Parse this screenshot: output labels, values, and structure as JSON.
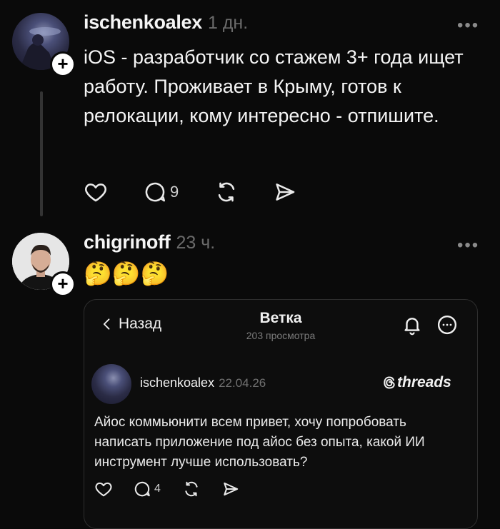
{
  "post1": {
    "username": "ischenkoalex",
    "time": "1 дн.",
    "text": "iOS - разработчик со стажем 3+ года ищет работу. Проживает в Крыму, готов к релокации, кому интересно - отпишите.",
    "more": "•••",
    "reply_count": "9",
    "plus": "+"
  },
  "post2": {
    "username": "chigrinoff",
    "time": "23 ч.",
    "emojis": "🤔🤔🤔",
    "more": "•••",
    "plus": "+"
  },
  "embedded": {
    "back_label": "Назад",
    "title": "Ветка",
    "views": "203 просмотра",
    "username": "ischenkoalex",
    "date": "22.04.26",
    "logo": "threads",
    "text": "Айос коммьюнити всем привет, хочу попробовать написать приложение под айос без опыта, какой ИИ инструмент лучше использовать?",
    "reply_count": "4"
  },
  "icons": [
    "heart-icon",
    "comment-icon",
    "repost-icon",
    "share-icon",
    "bell-icon",
    "more-circle-icon",
    "chevron-left-icon",
    "threads-logo-icon"
  ]
}
